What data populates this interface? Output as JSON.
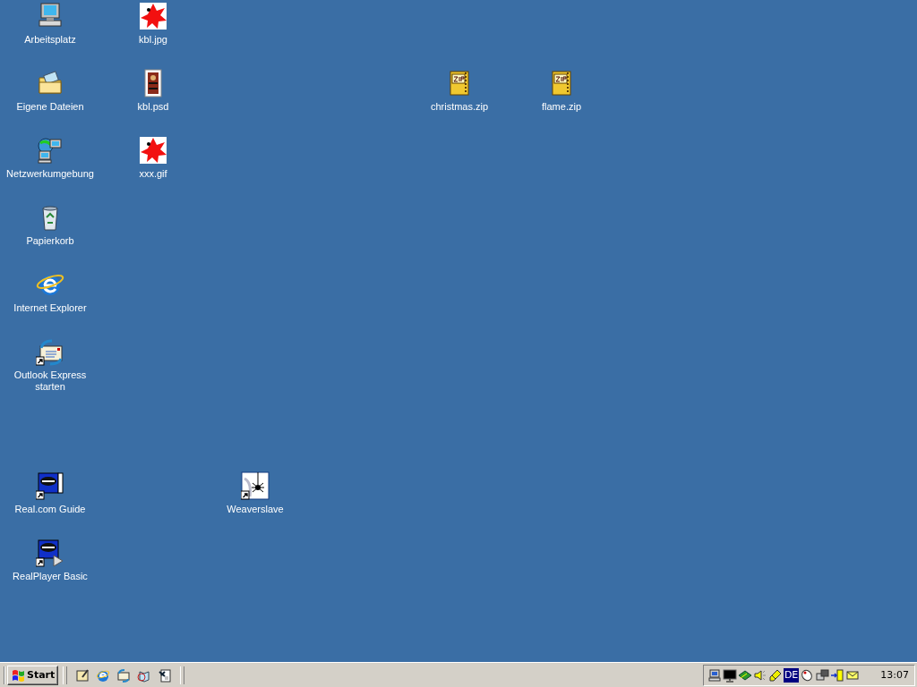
{
  "desktop_icons": [
    {
      "label": "Arbeitsplatz",
      "shortcut": false
    },
    {
      "label": "Eigene Dateien",
      "shortcut": false
    },
    {
      "label": "Netzwerkumgebung",
      "shortcut": false
    },
    {
      "label": "Papierkorb",
      "shortcut": false
    },
    {
      "label": "Internet Explorer",
      "shortcut": false
    },
    {
      "label": "Outlook Express starten",
      "shortcut": true
    },
    {
      "label": "Real.com Guide",
      "shortcut": true
    },
    {
      "label": "RealPlayer Basic",
      "shortcut": true
    },
    {
      "label": "kbl.jpg",
      "shortcut": false
    },
    {
      "label": "kbl.psd",
      "shortcut": false
    },
    {
      "label": "xxx.gif",
      "shortcut": false
    },
    {
      "label": "Weaverslave",
      "shortcut": true
    },
    {
      "label": "christmas.zip",
      "shortcut": false
    },
    {
      "label": "flame.zip",
      "shortcut": false
    }
  ],
  "taskbar": {
    "start_button": "Start",
    "tray": {
      "language": "DE",
      "clock": "13:07"
    }
  }
}
